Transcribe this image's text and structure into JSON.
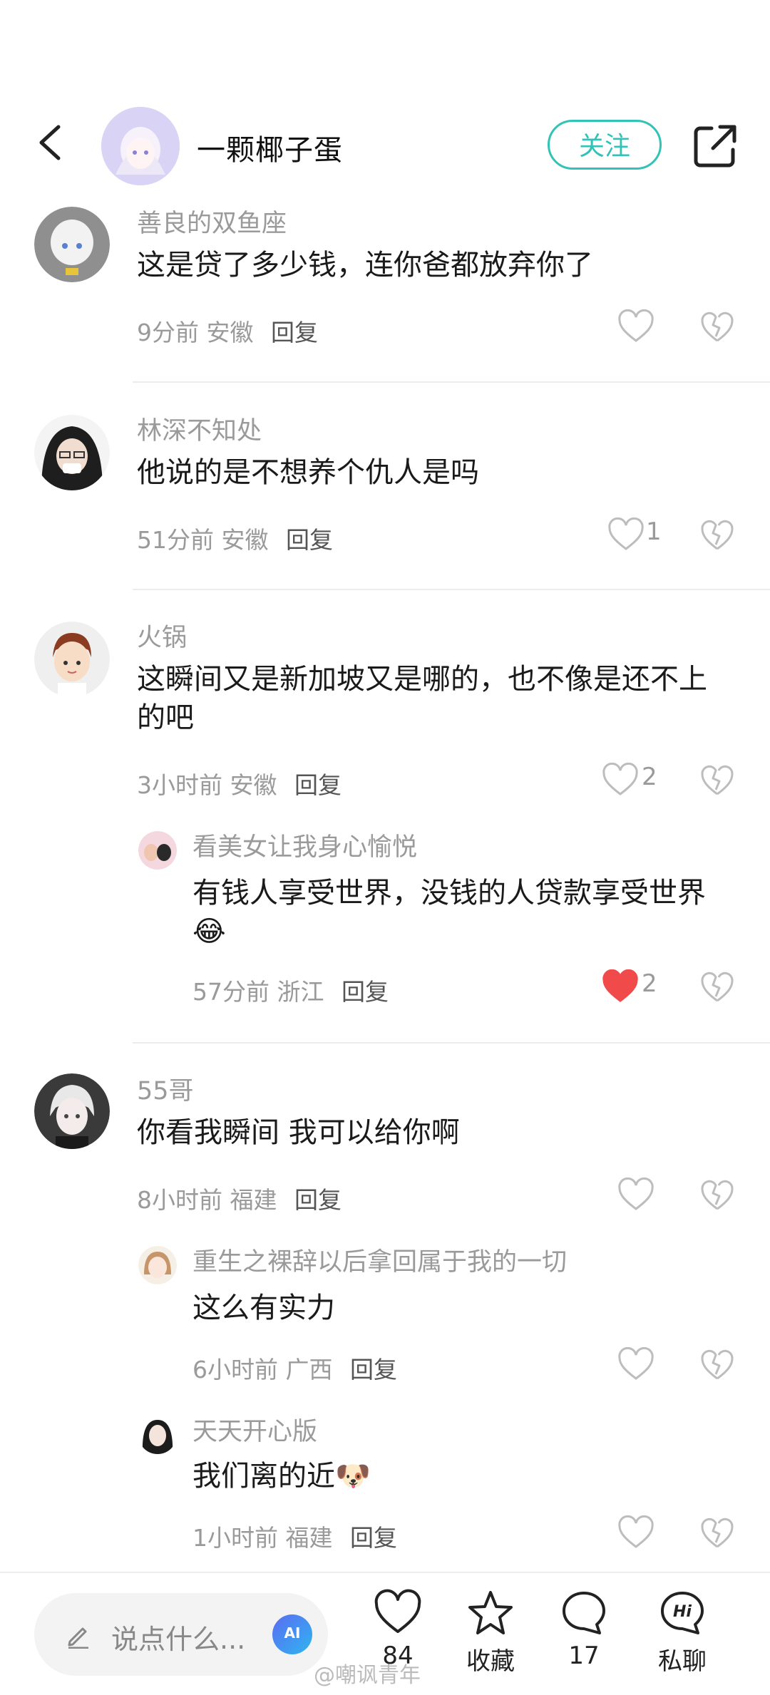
{
  "header": {
    "username": "一颗椰子蛋",
    "follow_label": "关注"
  },
  "comments": [
    {
      "user": "善良的双鱼座",
      "text": "这是贷了多少钱，连你爸都放弃你了",
      "time": "9分前",
      "location": "安徽",
      "reply": "回复",
      "likes": ""
    },
    {
      "user": "林深不知处",
      "text": "他说的是不想养个仇人是吗",
      "time": "51分前",
      "location": "安徽",
      "reply": "回复",
      "likes": "1"
    },
    {
      "user": "火锅",
      "text": "这瞬间又是新加坡又是哪的，也不像是还不上的吧",
      "time": "3小时前",
      "location": "安徽",
      "reply": "回复",
      "likes": "2",
      "replies": [
        {
          "user": "看美女让我身心愉悦",
          "text": "有钱人享受世界，没钱的人贷款享受世界😂",
          "time": "57分前",
          "location": "浙江",
          "reply": "回复",
          "likes": "2",
          "liked": true
        }
      ]
    },
    {
      "user": "55哥",
      "text": "你看我瞬间 我可以给你啊",
      "time": "8小时前",
      "location": "福建",
      "reply": "回复",
      "likes": "",
      "replies": [
        {
          "user": "重生之裸辞以后拿回属于我的一切",
          "text": "这么有实力",
          "time": "6小时前",
          "location": "广西",
          "reply": "回复",
          "likes": ""
        },
        {
          "user": "天天开心版",
          "text": "我们离的近🐶",
          "time": "1小时前",
          "location": "福建",
          "reply": "回复",
          "likes": ""
        }
      ]
    }
  ],
  "bottom_bar": {
    "input_placeholder": "说点什么...",
    "ai_label": "AI",
    "like_count": "84",
    "collect_label": "收藏",
    "comment_count": "17",
    "chat_label": "私聊",
    "chat_icon_text": "Hi"
  },
  "watermark": "@嘲讽青年",
  "colors": {
    "accent": "#33c2b6",
    "liked_heart": "#f04a4a",
    "meta_gray": "#9a9a9a"
  }
}
